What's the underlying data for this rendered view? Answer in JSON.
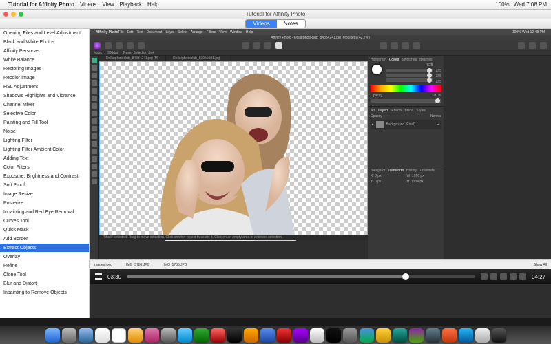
{
  "menubar": {
    "app": "Tutorial for Affinity Photo",
    "items": [
      "Videos",
      "View",
      "Playback",
      "Help"
    ],
    "status": {
      "wifi": "􀙇",
      "vol": "􀊨",
      "battery": "100%",
      "clock": "Wed 7:08 PM"
    }
  },
  "window": {
    "title": "Tutorial for Affinity Photo"
  },
  "seg": {
    "videos": "Videos",
    "notes": "Notes"
  },
  "sidebar": {
    "items": [
      "Opening Files and Level Adjustment",
      "Black and White Photos",
      "Affinity Personas",
      "White Balance",
      "Restoring Images",
      "Recolor Image",
      "HSL Adjustment",
      "Shadows Highlights and Vibrance",
      "Channel Mixer",
      "Selective Color",
      "Painting and Fill Tool",
      "Noise",
      "Lighting Filter",
      "Lighting Filter Ambient Color",
      "Adding Text",
      "Color Filters",
      "Exposure, Brightness and Contrast",
      "Soft Proof",
      "Image Resize",
      "Posterize",
      "Inpainting and Red Eye Removal",
      "Curves Tool",
      "Quick Mask",
      "Add Border",
      "Extract Objects",
      "Overlay",
      "Refine",
      "Clone Tool",
      "Blur and Distort",
      "Inpainting to Remove Objects"
    ],
    "selected": 24
  },
  "inner_menubar": {
    "app": "Affinity Photo",
    "items": [
      "File",
      "Edit",
      "Text",
      "Document",
      "Layer",
      "Select",
      "Arrange",
      "Filters",
      "View",
      "Window",
      "Help"
    ],
    "status": "100%  Wed 10:48 PM"
  },
  "aff": {
    "doc_title": "Affinity Photo - Dollarphotoclub_84334241.jpg [Modified] (42.7%)",
    "bar2": {
      "mask": "Mask",
      "dpi": "300dpi",
      "reset": "Reset Selection Box"
    },
    "tabs": [
      "Dollarphotoclub_84334241.jpg [M]",
      "Dollarphotoclub_87059581.jpg"
    ],
    "panels": {
      "tabs1": [
        "Histogram",
        "Colour",
        "Swatches",
        "Brushes"
      ],
      "rgb": "RGB",
      "ch": [
        "R",
        "G",
        "B"
      ],
      "val": "255",
      "opacity": "Opacity",
      "opv": "100 %",
      "tabs2": [
        "Adj",
        "Layers",
        "Effects",
        "Brshs",
        "Styles"
      ],
      "blend": "Normal",
      "layer": "Background (Pixel)",
      "tabs3": [
        "Navigator",
        "Transform",
        "History",
        "Channels"
      ],
      "tx": "X: 0 px",
      "ty": "Y: 0 px",
      "tw": "W: 1996 px",
      "th": "H: 1334 px"
    },
    "hint": "'Mask' selected. Drag to move selection. Click another object to select it. Click on an empty area to deselect selection."
  },
  "thumbs": {
    "left": "images.jpeg",
    "a": "IMG_5786.JPG",
    "b": "IMG_5785.JPG",
    "showall": "Show All"
  },
  "scrub": {
    "cur": "03:30",
    "total": "04:27"
  }
}
